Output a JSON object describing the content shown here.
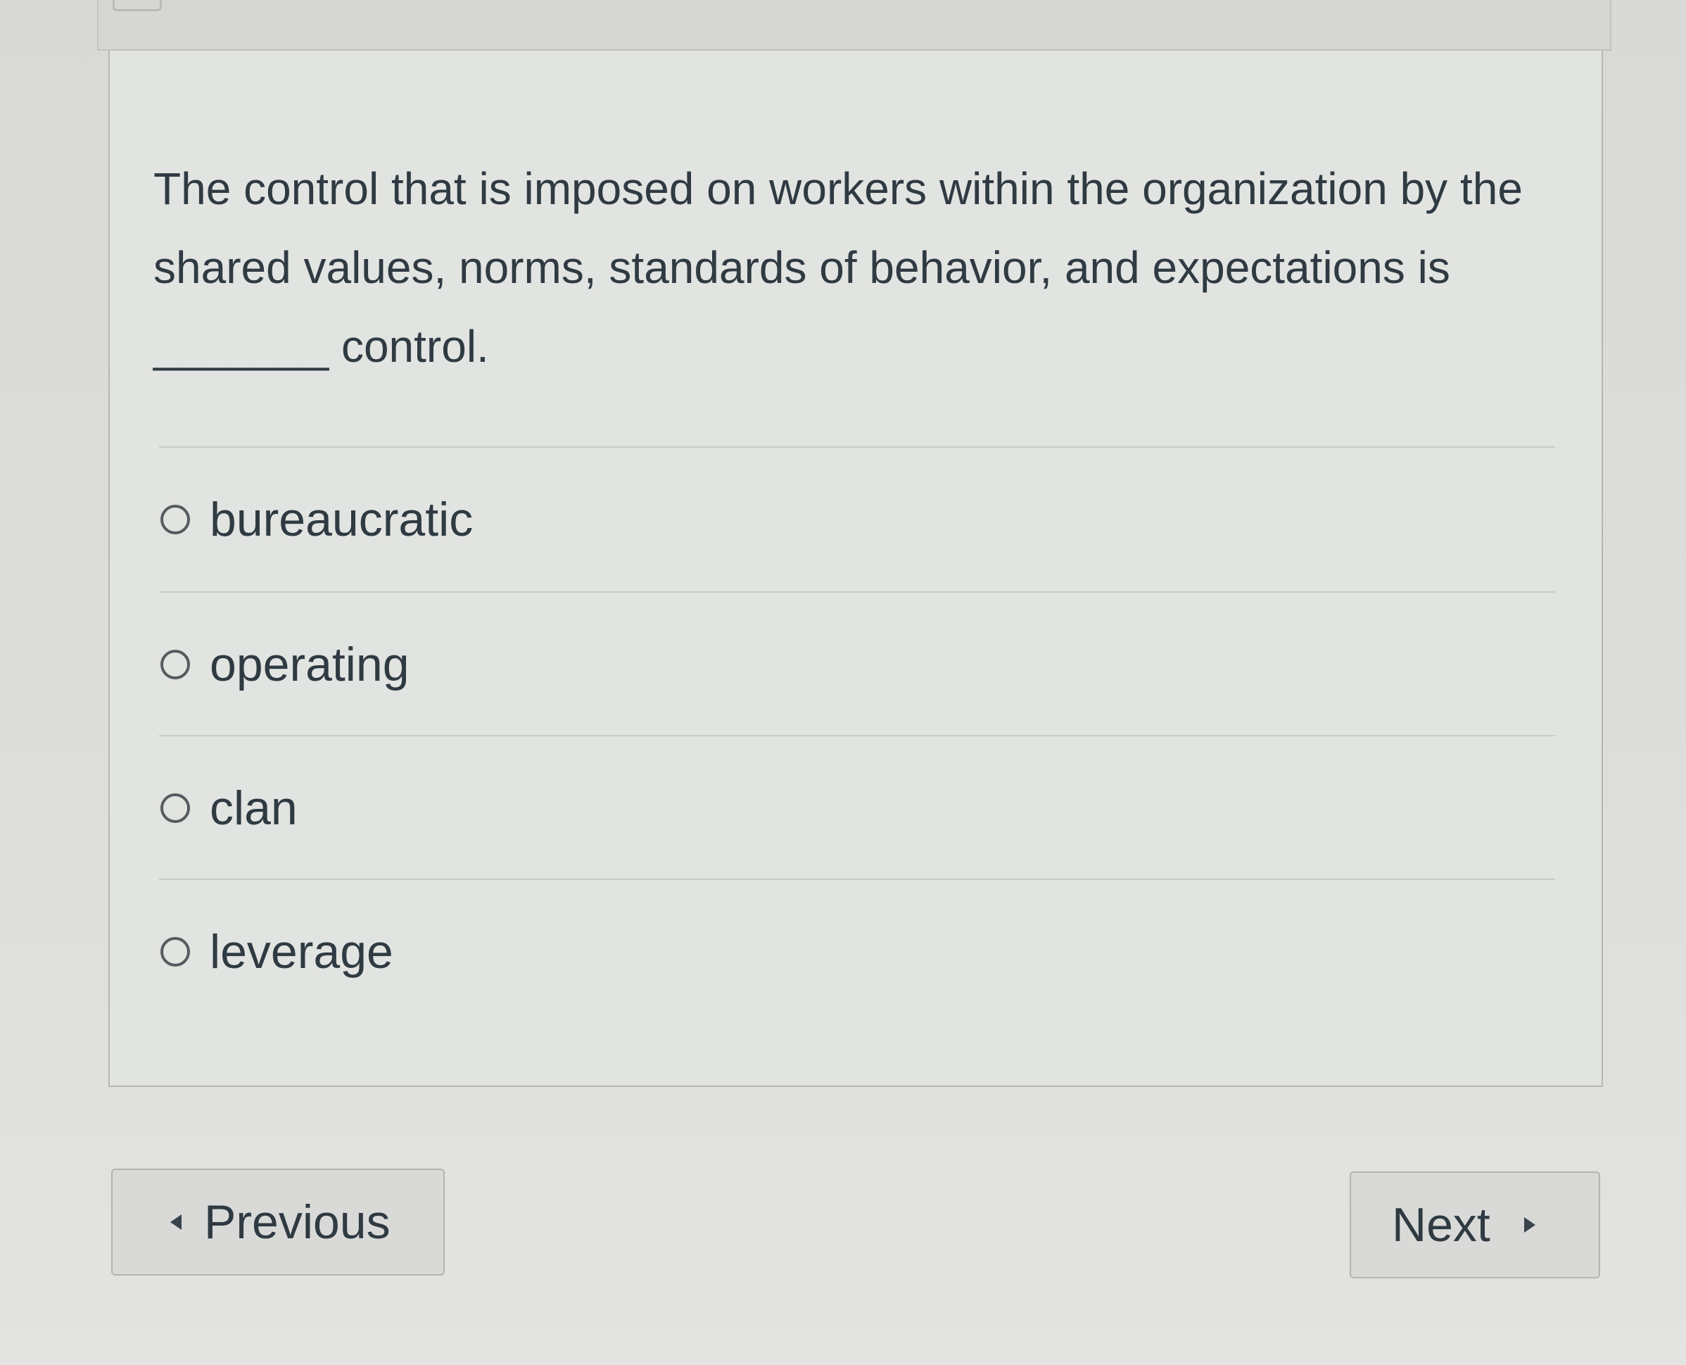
{
  "question": {
    "text": "The control that is imposed on workers within the organization by the shared values, norms, standards of behavior, and expectations is _______ control."
  },
  "answers": [
    {
      "label": "bureaucratic",
      "selected": false
    },
    {
      "label": "operating",
      "selected": false
    },
    {
      "label": "clan",
      "selected": false
    },
    {
      "label": "leverage",
      "selected": false
    }
  ],
  "navigation": {
    "previous_label": "Previous",
    "next_label": "Next"
  },
  "icons": {
    "previous": "caret-left-icon",
    "next": "caret-right-icon",
    "radio": "radio-unchecked-icon"
  }
}
